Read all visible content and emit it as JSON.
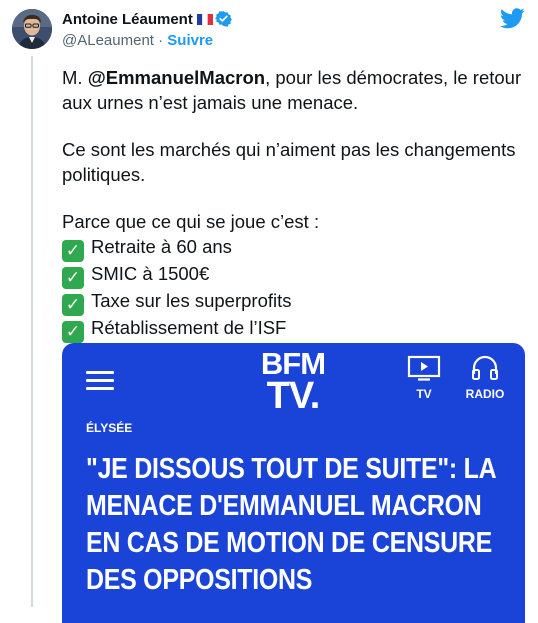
{
  "tweet": {
    "author_name": "Antoine Léaument",
    "flag_icon": "french-flag-icon",
    "verified_icon": "verified-badge-icon",
    "handle": "@ALeaument",
    "separator": " · ",
    "follow_label": "Suivre",
    "twitter_logo": "twitter-bird-icon",
    "text": {
      "line1_prefix": "M. ",
      "mention": "@EmmanuelMacron",
      "line1_suffix": ", pour les démocrates, le retour aux urnes n’est jamais une menace.",
      "paragraph2": "Ce sont les marchés qui n’aiment pas les changements politiques.",
      "paragraph3_intro": "Parce que ce qui se joue c’est :",
      "check_glyph": "✓",
      "items": [
        "Retraite à 60 ans",
        "SMIC à 1500€",
        "Taxe sur les superprofits",
        "Rétablissement de l’ISF"
      ]
    }
  },
  "card": {
    "background": "#1a44d8",
    "logo_line1": "BFM",
    "logo_line2": "TV.",
    "nav_tv_label": "TV",
    "nav_radio_label": "RADIO",
    "category": "ÉLYSÉE",
    "headline": "\"JE DISSOUS TOUT DE SUITE\": LA MENACE D'EMMANUEL MACRON EN CAS DE MOTION DE CENSURE DES OPPOSITIONS"
  },
  "colors": {
    "link": "#1d9bf0",
    "secondary_text": "#536471",
    "check_green": "#2fa84f"
  }
}
